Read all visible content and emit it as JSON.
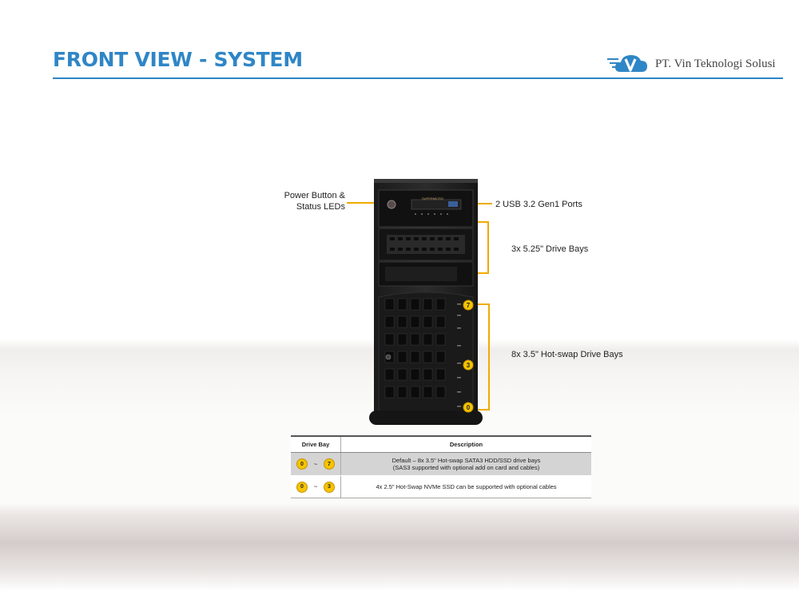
{
  "header": {
    "title": "FRONT VIEW - SYSTEM",
    "company": "PT. Vin Teknologi Solusi"
  },
  "callouts": {
    "power_line1": "Power Button &",
    "power_line2": "Status LEDs",
    "usb": "2 USB 3.2 Gen1 Ports",
    "bays_525": "3x 5.25\" Drive Bays",
    "hotswap": "8x 3.5\" Hot-swap Drive Bays"
  },
  "bay_markers": [
    "7",
    "3",
    "0"
  ],
  "server": {
    "brand": "SUPERMICRO"
  },
  "table": {
    "headers": [
      "Drive Bay",
      "Description"
    ],
    "rows": [
      {
        "from": "0",
        "sep": "~",
        "to": "7",
        "description_line1": "Default – 8x 3.5\" Hot-swap SATA3 HDD/SSD drive bays",
        "description_line2": "(SAS3 supported with optional add on card and cables)"
      },
      {
        "from": "0",
        "sep": "~",
        "to": "3",
        "description_line1": "4x 2.5\" Hot-Swap NVMe SSD can be supported with optional cables"
      }
    ]
  },
  "colors": {
    "title_blue": "#2f86c6",
    "callout_line": "#f0ab00",
    "badge_yellow": "#f5c400"
  }
}
